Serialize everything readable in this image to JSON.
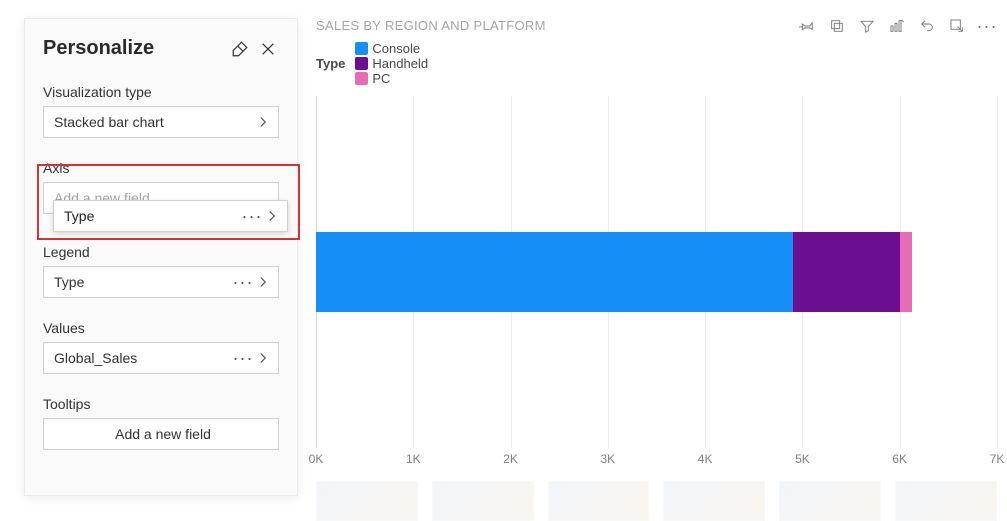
{
  "panel": {
    "title": "Personalize",
    "sections": {
      "viz_type": {
        "label": "Visualization type",
        "value": "Stacked bar chart"
      },
      "axis": {
        "label": "Axis",
        "placeholder": "Add a new field"
      },
      "legend": {
        "label": "Legend",
        "value": "Type"
      },
      "values": {
        "label": "Values",
        "value": "Global_Sales"
      },
      "tooltips": {
        "label": "Tooltips",
        "add_label": "Add a new field"
      }
    },
    "drag_pill": "Type"
  },
  "chart": {
    "title": "SALES BY REGION AND PLATFORM",
    "legend_title": "Type",
    "legend": [
      {
        "name": "Console",
        "color": "#168ef7"
      },
      {
        "name": "Handheld",
        "color": "#6b0e8f"
      },
      {
        "name": "PC",
        "color": "#e86bb5"
      }
    ],
    "axis_ticks": [
      "0K",
      "1K",
      "2K",
      "3K",
      "4K",
      "5K",
      "6K",
      "7K"
    ]
  },
  "chart_data": {
    "type": "bar",
    "orientation": "horizontal",
    "stacked": true,
    "title": "SALES BY REGION AND PLATFORM",
    "xlabel": "",
    "ylabel": "",
    "xlim": [
      0,
      7000
    ],
    "categories": [
      ""
    ],
    "series": [
      {
        "name": "Console",
        "values": [
          4900
        ],
        "color": "#168ef7"
      },
      {
        "name": "Handheld",
        "values": [
          1100
        ],
        "color": "#6b0e8f"
      },
      {
        "name": "PC",
        "values": [
          130
        ],
        "color": "#e86bb5"
      }
    ],
    "legend_position": "top",
    "grid": true
  }
}
